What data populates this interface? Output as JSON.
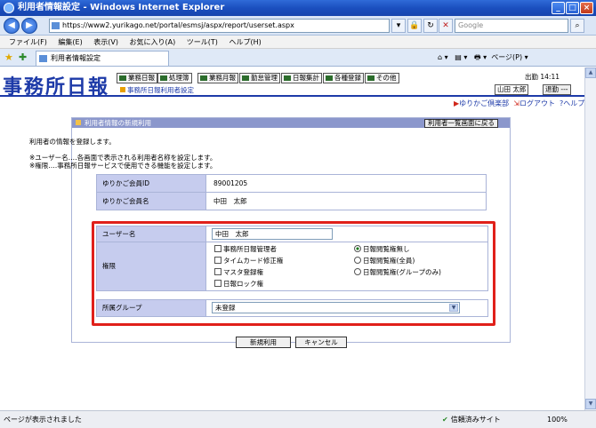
{
  "browser": {
    "title": "利用者情報設定 - Windows Internet Explorer",
    "url": "https://www2.yurikago.net/portal/esmsj/aspx/report/userset.aspx",
    "search_placeholder": "Google",
    "menu": [
      "ファイル(F)",
      "編集(E)",
      "表示(V)",
      "お気に入り(A)",
      "ツール(T)",
      "ヘルプ(H)"
    ],
    "tab_title": "利用者情報設定",
    "tools_text": "ページ(P) ▾",
    "status_text": "ページが表示されました",
    "zone_text": "信頼済みサイト",
    "zoom_text": "100%"
  },
  "app": {
    "logo": "事務所日報",
    "nav": [
      "業務日報",
      "処理簿",
      "業務月報",
      "勤怠管理",
      "日報集計",
      "各種登録",
      "その他"
    ],
    "subtitle": "事務所日報利用者設定",
    "clock": "出勤 14:11",
    "user_name": "山田 太郎",
    "leave_label": "退勤 ---",
    "link_club": "ゆりかご倶楽部",
    "link_logout": "ログアウト",
    "link_help": "ヘルプ"
  },
  "panel": {
    "title": "利用者情報の新規利用",
    "back_button": "利用者一覧画面に戻る",
    "intro": "利用者の情報を登録します。",
    "note1": "※ユーザー名‥‥各画面で表示される利用者名称を設定します。",
    "note2": "※権限‥‥事務所日報サービスで使用できる機能を設定します。",
    "member_id_label": "ゆりかご会員ID",
    "member_id_value": "89001205",
    "member_name_label": "ゆりかご会員名",
    "member_name_value": "中田　太郎",
    "username_label": "ユーザー名",
    "username_value": "中田　太郎",
    "permission_label": "権限",
    "checkboxes": [
      {
        "label": "事務所日報管理者",
        "checked": false
      },
      {
        "label": "タイムカード修正権",
        "checked": false
      },
      {
        "label": "マスタ登録権",
        "checked": false
      },
      {
        "label": "日報ロック権",
        "checked": false
      }
    ],
    "radios": [
      {
        "label": "日報閲覧権無し",
        "selected": true
      },
      {
        "label": "日報閲覧権(全員)",
        "selected": false
      },
      {
        "label": "日報閲覧権(グループのみ)",
        "selected": false
      }
    ],
    "group_label": "所属グループ",
    "group_value": "未登録",
    "submit_button": "新規利用",
    "cancel_button": "キャンセル"
  }
}
